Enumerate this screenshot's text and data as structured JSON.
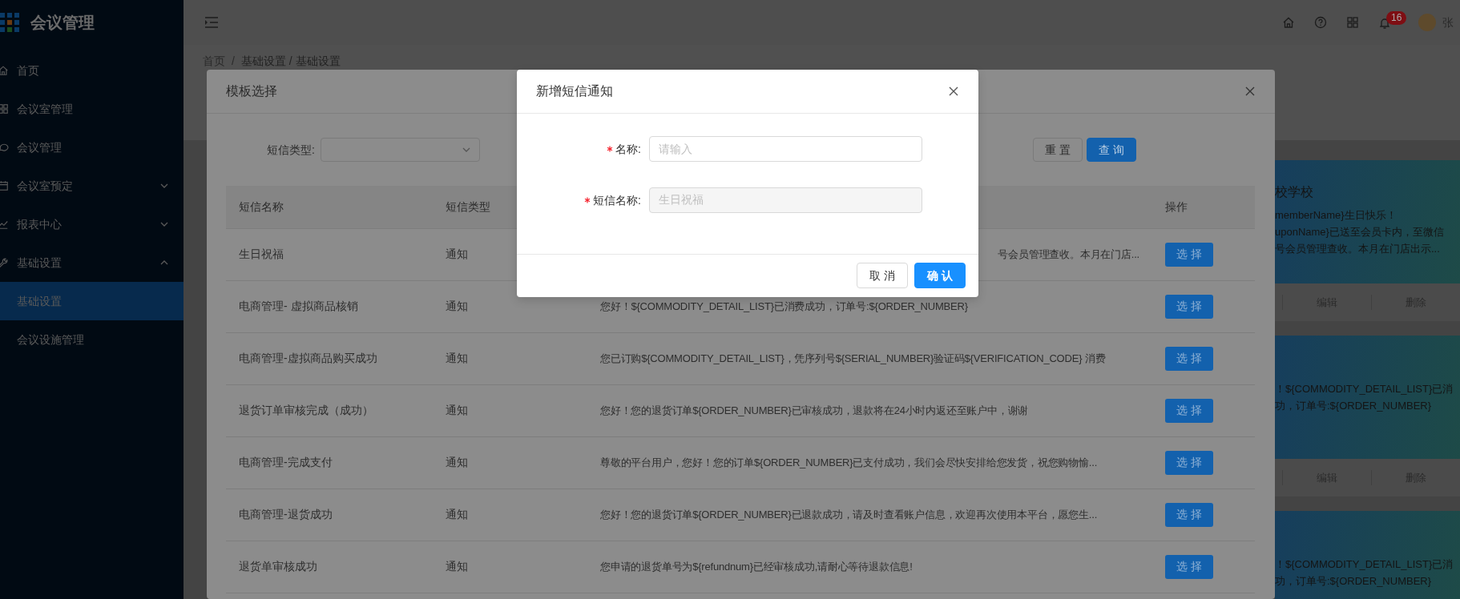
{
  "sidebar": {
    "title": "会议管理",
    "items": [
      {
        "label": "首页",
        "selected": false
      },
      {
        "label": "会议室管理",
        "selected": false
      },
      {
        "label": "会议管理",
        "selected": false
      },
      {
        "label": "会议室预定",
        "selected": false,
        "expanded": false
      },
      {
        "label": "报表中心",
        "selected": false,
        "expanded": false
      },
      {
        "label": "基础设置",
        "selected": false,
        "expanded": true,
        "children": [
          {
            "label": "基础设置",
            "selected": true
          },
          {
            "label": "会议设施管理",
            "selected": false
          }
        ]
      }
    ]
  },
  "header": {
    "notification_count": "16",
    "user_name": "张"
  },
  "breadcrumb": {
    "items": [
      "首页",
      "基础设置 / 基础设置"
    ],
    "separator": "/"
  },
  "cards": [
    {
      "title": "校学校",
      "lines": [
        "memberName}生日快乐！",
        "uponName}已送至会员卡内，至微信",
        "号会员管理查收。本月在门店出示..."
      ],
      "actions": [
        "编辑",
        "删除"
      ]
    },
    {
      "lines": [
        "！${COMMODITY_DETAIL_LIST}已消",
        "功，订单号:${ORDER_NUMBER}"
      ],
      "actions": [
        "编辑",
        "删除"
      ]
    },
    {
      "lines": [
        "！${COMMODITY_DETAIL_LIST}已消",
        "功，订单号:${ORDER_NUMBER}"
      ]
    }
  ],
  "template_dialog": {
    "title": "模板选择",
    "filter": {
      "label": "短信类型:"
    },
    "buttons": [
      {
        "label": "重 置",
        "kind": "default"
      },
      {
        "label": "查 询",
        "kind": "primary"
      }
    ],
    "table": {
      "name_header": "短信名称",
      "type_header": "短信类型",
      "action_header": "操作",
      "rows": [
        {
          "name": "生日祝福",
          "type": "通知",
          "content": "号会员管理查收。本月在门店...",
          "action": "选 择"
        },
        {
          "name": "电商管理- 虚拟商品核销",
          "type": "通知",
          "content": "您好！${COMMODITY_DETAIL_LIST}已消费成功，订单号:${ORDER_NUMBER}",
          "action": "选 择"
        },
        {
          "name": "电商管理-虚拟商品购买成功",
          "type": "通知",
          "content": "您已订购${COMMODITY_DETAIL_LIST}，凭序列号${SERIAL_NUMBER}验证码${VERIFICATION_CODE} 消费",
          "action": "选 择"
        },
        {
          "name": "退货订单审核完成（成功）",
          "type": "通知",
          "content": "您好！您的退货订单${ORDER_NUMBER}已审核成功，退款将在24小时内返还至账户中，谢谢",
          "action": "选 择"
        },
        {
          "name": "电商管理-完成支付",
          "type": "通知",
          "content": "尊敬的平台用户，您好！您的订单${ORDER_NUMBER}已支付成功，我们会尽快安排给您发货，祝您购物愉...",
          "action": "选 择"
        },
        {
          "name": "电商管理-退货成功",
          "type": "通知",
          "content": "您好！您的退货订单${ORDER_NUMBER}已退款成功，请及时查看账户信息，欢迎再次使用本平台，愿您生...",
          "action": "选 择"
        },
        {
          "name": "退货单审核成功",
          "type": "通知",
          "content": "您申请的退货单号为${refundnum}已经审核成功,请耐心等待退款信息!",
          "action": "选 择"
        }
      ]
    }
  },
  "sms_dialog": {
    "title": "新增短信通知",
    "fields": [
      {
        "label": "名称:",
        "required": true,
        "placeholder": "请输入",
        "disabled": false
      },
      {
        "label": "短信名称:",
        "required": true,
        "value": "生日祝福",
        "disabled": true
      }
    ],
    "buttons": [
      {
        "label": "取 消",
        "kind": "default"
      },
      {
        "label": "确 认",
        "kind": "primary"
      }
    ]
  }
}
